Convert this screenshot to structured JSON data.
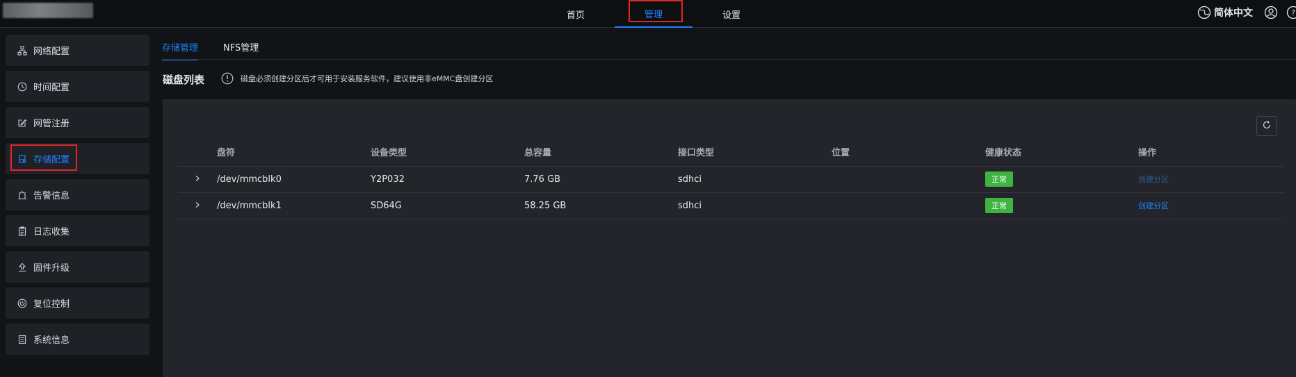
{
  "header": {
    "nav": [
      {
        "label": "首页"
      },
      {
        "label": "管理"
      },
      {
        "label": "设置"
      }
    ],
    "language": "简体中文"
  },
  "sidebar": {
    "items": [
      {
        "label": "网络配置",
        "icon": "network-icon"
      },
      {
        "label": "时间配置",
        "icon": "clock-icon"
      },
      {
        "label": "网管注册",
        "icon": "edit-icon"
      },
      {
        "label": "存储配置",
        "icon": "storage-icon"
      },
      {
        "label": "告警信息",
        "icon": "alarm-icon"
      },
      {
        "label": "日志收集",
        "icon": "clipboard-icon"
      },
      {
        "label": "固件升级",
        "icon": "upgrade-icon"
      },
      {
        "label": "复位控制",
        "icon": "power-icon"
      },
      {
        "label": "系统信息",
        "icon": "document-icon"
      }
    ],
    "active_index": 3
  },
  "main": {
    "tabs": [
      {
        "label": "存储管理"
      },
      {
        "label": "NFS管理"
      }
    ],
    "section_title": "磁盘列表",
    "notice": "磁盘必须创建分区后才可用于安装服务软件，建议使用非eMMC盘创建分区",
    "table": {
      "columns": [
        "盘符",
        "设备类型",
        "总容量",
        "接口类型",
        "位置",
        "健康状态",
        "操作"
      ],
      "rows": [
        {
          "drive": "/dev/mmcblk0",
          "device_type": "Y2P032",
          "capacity": "7.76 GB",
          "interface": "sdhci",
          "location": "",
          "health": "正常",
          "action": "创建分区"
        },
        {
          "drive": "/dev/mmcblk1",
          "device_type": "SD64G",
          "capacity": "58.25 GB",
          "interface": "sdhci",
          "location": "",
          "health": "正常",
          "action": "创建分区"
        }
      ]
    }
  },
  "colors": {
    "accent": "#1e82ff",
    "highlight_box": "#e0262a",
    "healthy": "#3fb33f",
    "background": "#121316",
    "panel": "#23252b"
  }
}
